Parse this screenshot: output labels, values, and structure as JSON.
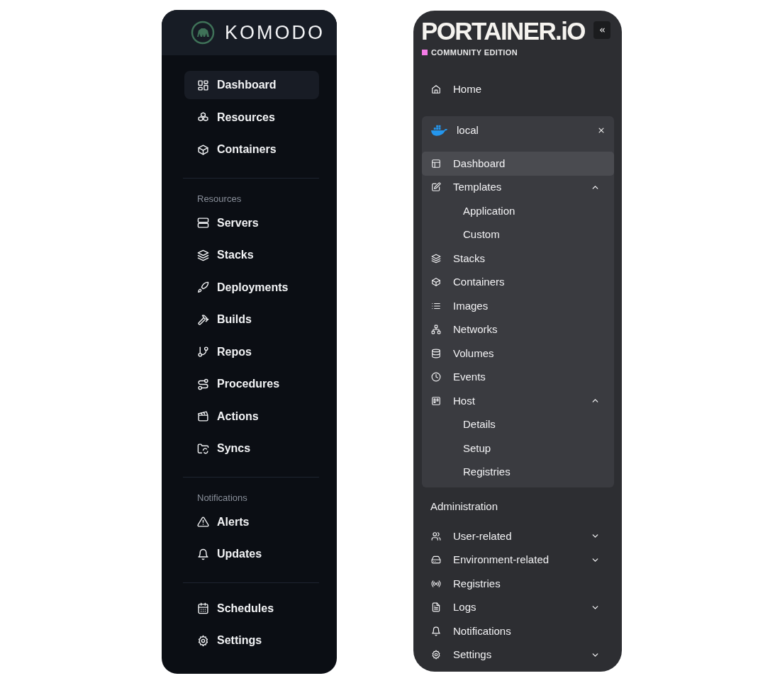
{
  "komodo": {
    "brand": "KOMODO",
    "sections": [
      {
        "items": [
          {
            "label": "Dashboard",
            "selected": true
          },
          {
            "label": "Resources",
            "selected": false
          },
          {
            "label": "Containers",
            "selected": false
          }
        ]
      },
      {
        "heading": "Resources",
        "items": [
          {
            "label": "Servers",
            "selected": false
          },
          {
            "label": "Stacks",
            "selected": false
          },
          {
            "label": "Deployments",
            "selected": false
          },
          {
            "label": "Builds",
            "selected": false
          },
          {
            "label": "Repos",
            "selected": false
          },
          {
            "label": "Procedures",
            "selected": false
          },
          {
            "label": "Actions",
            "selected": false
          },
          {
            "label": "Syncs",
            "selected": false
          }
        ]
      },
      {
        "heading": "Notifications",
        "items": [
          {
            "label": "Alerts",
            "selected": false
          },
          {
            "label": "Updates",
            "selected": false
          }
        ]
      },
      {
        "items": [
          {
            "label": "Schedules",
            "selected": false
          },
          {
            "label": "Settings",
            "selected": false
          }
        ]
      }
    ]
  },
  "portainer": {
    "brand": "PORTAINER.iO",
    "edition": "COMMUNITY EDITION",
    "home": {
      "label": "Home",
      "selected": false
    },
    "environment": {
      "name": "local",
      "items": [
        {
          "label": "Dashboard",
          "selected": true
        },
        {
          "label": "Templates",
          "selected": false,
          "expanded": true,
          "children": [
            {
              "label": "Application",
              "selected": false
            },
            {
              "label": "Custom",
              "selected": false
            }
          ]
        },
        {
          "label": "Stacks",
          "selected": false
        },
        {
          "label": "Containers",
          "selected": false
        },
        {
          "label": "Images",
          "selected": false
        },
        {
          "label": "Networks",
          "selected": false
        },
        {
          "label": "Volumes",
          "selected": false
        },
        {
          "label": "Events",
          "selected": false
        },
        {
          "label": "Host",
          "selected": false,
          "expanded": true,
          "children": [
            {
              "label": "Details",
              "selected": false
            },
            {
              "label": "Setup",
              "selected": false
            },
            {
              "label": "Registries",
              "selected": false
            }
          ]
        }
      ]
    },
    "administration": {
      "heading": "Administration",
      "items": [
        {
          "label": "User-related",
          "selected": false,
          "expanded": false
        },
        {
          "label": "Environment-related",
          "selected": false,
          "expanded": false
        },
        {
          "label": "Registries",
          "selected": false
        },
        {
          "label": "Logs",
          "selected": false,
          "expanded": false
        },
        {
          "label": "Notifications",
          "selected": false
        },
        {
          "label": "Settings",
          "selected": false,
          "expanded": false
        }
      ]
    }
  }
}
